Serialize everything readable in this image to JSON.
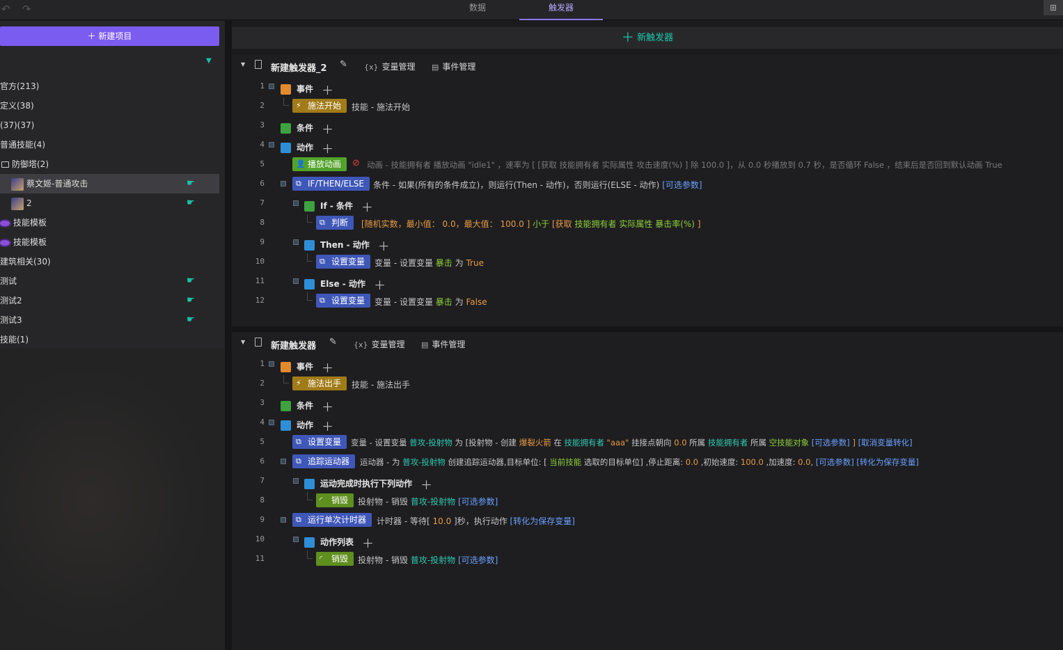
{
  "topbar": {
    "tabs": [
      "数据",
      "触发器"
    ],
    "undo_icon": "undo-icon",
    "redo_icon": "redo-icon",
    "corner_icon": "panel-icon"
  },
  "sidebar": {
    "new_project": "新建项目",
    "items": [
      {
        "label": "官方(213)"
      },
      {
        "label": "定义(38)"
      },
      {
        "label": "(37)(37)"
      },
      {
        "label": "普通技能(4)"
      },
      {
        "label": "防御塔(2)"
      },
      {
        "label": "蔡文姬-普通攻击"
      },
      {
        "label": "2"
      },
      {
        "label": "技能模板"
      },
      {
        "label": "技能模板"
      },
      {
        "label": "建筑相关(30)"
      },
      {
        "label": "测试"
      },
      {
        "label": "测试2"
      },
      {
        "label": "测试3"
      },
      {
        "label": "技能(1)"
      }
    ]
  },
  "main": {
    "new_trigger": "新触发器"
  },
  "triggers": [
    {
      "title": "新建触发器_2",
      "var_mgr": "变量管理",
      "evt_mgr": "事件管理",
      "rows": [
        {
          "n": "1",
          "cat": "事件"
        },
        {
          "n": "2",
          "chip": "施法开始",
          "text": "技能 - 施法开始"
        },
        {
          "n": "3",
          "cat": "条件"
        },
        {
          "n": "4",
          "cat": "动作"
        },
        {
          "n": "5",
          "chip": "播放动画",
          "p1": "动画 -  技能拥有者 播放动画 \"idle1\" ，速率为 [ [获取 技能拥有者  实际属性  攻击速度(%) ]  除  100.0 ]，从 0.0 秒播放到 0.7 秒，是否循环 False ，结束后是否回到默认动画 True"
        },
        {
          "n": "6",
          "chip": "IF/THEN/ELSE",
          "p1": "条件 - 如果(所有的条件成立)，则运行(Then - 动作)，否则运行(ELSE - 动作) ",
          "p2": "[可选参数]"
        },
        {
          "n": "7",
          "cat": "If - 条件"
        },
        {
          "n": "8",
          "chip": "判断",
          "p1": "[随机实数，最小值：",
          "p2": "0.0",
          "p3": "，最大值：",
          "p4": "100.0",
          "p5": "]",
          "p6": "小于",
          "p7": "[获取",
          "p8": "技能拥有者",
          "p9": "实际属性",
          "p10": "暴击率(%)",
          "p11": "]"
        },
        {
          "n": "9",
          "cat": "Then - 动作"
        },
        {
          "n": "10",
          "chip": "设置变量",
          "p1": "变量 - 设置变量",
          "p2": "暴击",
          "p3": "为",
          "p4": "True"
        },
        {
          "n": "11",
          "cat": "Else - 动作"
        },
        {
          "n": "12",
          "chip": "设置变量",
          "p1": "变量 - 设置变量",
          "p2": "暴击",
          "p3": "为",
          "p4": "False"
        }
      ]
    },
    {
      "title": "新建触发器",
      "var_mgr": "变量管理",
      "evt_mgr": "事件管理",
      "rows": [
        {
          "n": "1",
          "cat": "事件"
        },
        {
          "n": "2",
          "chip": "施法出手",
          "text": "技能 - 施法出手"
        },
        {
          "n": "3",
          "cat": "条件"
        },
        {
          "n": "4",
          "cat": "动作"
        },
        {
          "n": "5",
          "chip": "设置变量",
          "p1": "变量 - 设置变量",
          "p2": "普攻-投射物",
          "p3": "为 [投射物 - 创建",
          "p4": "爆裂火箭",
          "p5": "在",
          "p6": "技能拥有者",
          "p7": "\"aaa\"",
          "p8": "挂接点朝向",
          "p9": "0.0",
          "p10": "所属",
          "p11": "技能拥有者",
          "p12": "所属",
          "p13": "空技能对象",
          "p14": "[可选参数]",
          "p15": "]",
          "p16": "[取消变量转化]"
        },
        {
          "n": "6",
          "chip": "追踪运动器",
          "p1": "运动器 - 为",
          "p2": "普攻-投射物",
          "p3": "创建追踪运动器,目标单位: [",
          "p4": "当前技能",
          "p5": "选取的目标单位] ,停止距离:",
          "p6": "0.0",
          "p7": ",初始速度:",
          "p8": "100.0",
          "p9": ",加速度:",
          "p10": "0.0",
          "p11": ",",
          "p12": "[可选参数]",
          "p13": "[转化为保存变量]"
        },
        {
          "n": "7",
          "cat": "运动完成时执行下列动作"
        },
        {
          "n": "8",
          "chip": "销毁",
          "p1": "投射物 - 销毁",
          "p2": "普攻-投射物",
          "p3": "[可选参数]"
        },
        {
          "n": "9",
          "chip": "运行单次计时器",
          "p1": "计时器 - 等待[",
          "p2": "10.0",
          "p3": "]秒，执行动作",
          "p4": "[转化为保存变量]"
        },
        {
          "n": "10",
          "cat": "动作列表"
        },
        {
          "n": "11",
          "chip": "销毁",
          "p1": "投射物 - 销毁",
          "p2": "普攻-投射物",
          "p3": "[可选参数]"
        }
      ]
    }
  ],
  "colors": {
    "accent": "#7b5cf0",
    "teal": "#1cc7ab",
    "orange": "#e89a44",
    "green": "#8dd03a",
    "blue": "#6aa0ff"
  }
}
